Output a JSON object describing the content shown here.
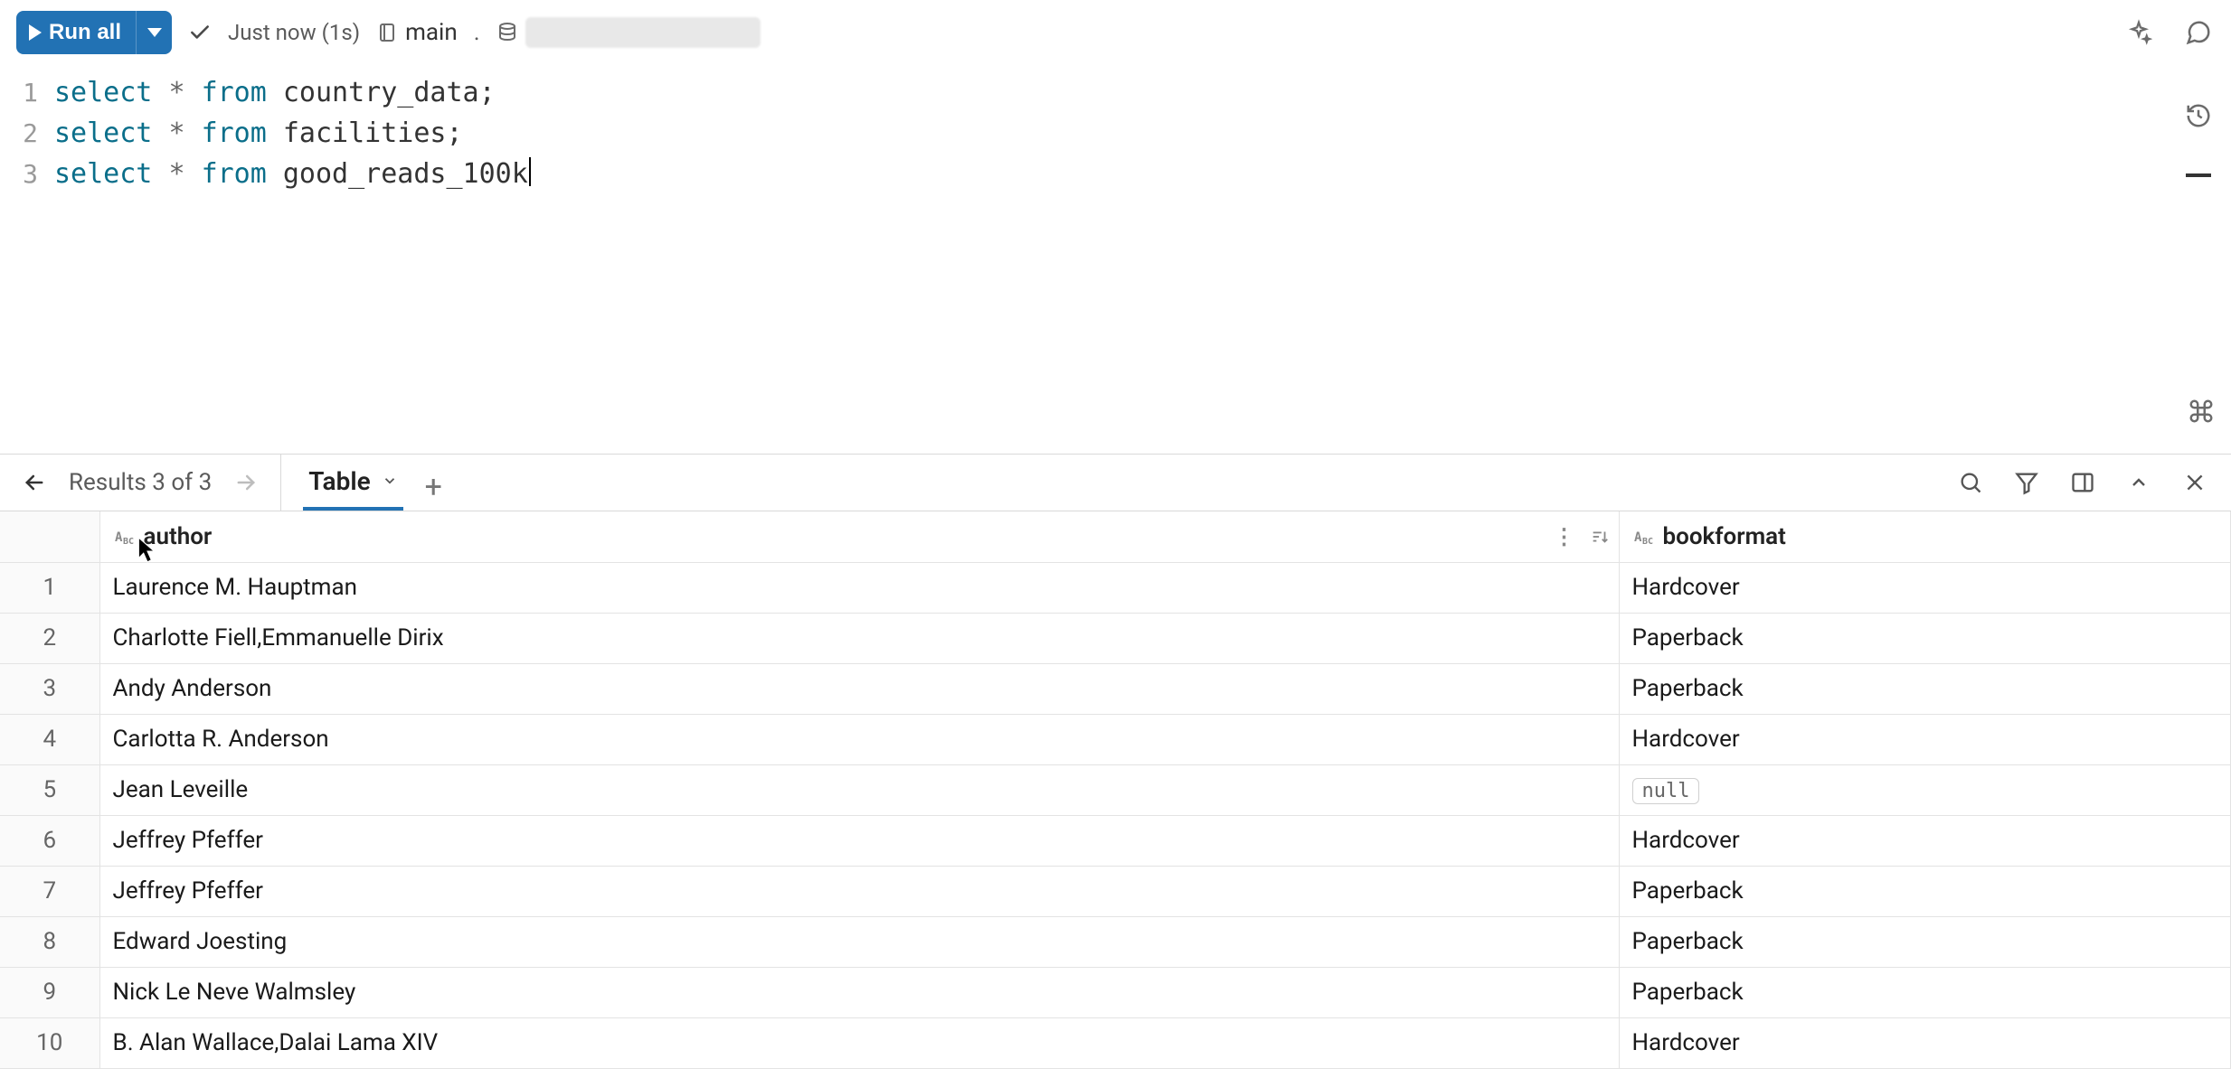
{
  "toolbar": {
    "run_all_label": "Run all",
    "status_text": "Just now (1s)",
    "catalog_name": "main",
    "schema_name_redacted": true
  },
  "editor": {
    "lines": [
      {
        "n": "1",
        "tokens": [
          {
            "t": "select",
            "c": "kw"
          },
          {
            "t": " ",
            "c": ""
          },
          {
            "t": "*",
            "c": "op"
          },
          {
            "t": " ",
            "c": ""
          },
          {
            "t": "from",
            "c": "kw"
          },
          {
            "t": " ",
            "c": ""
          },
          {
            "t": "country_data",
            "c": "id"
          },
          {
            "t": ";",
            "c": "punc"
          }
        ]
      },
      {
        "n": "2",
        "tokens": [
          {
            "t": "select",
            "c": "kw"
          },
          {
            "t": " ",
            "c": ""
          },
          {
            "t": "*",
            "c": "op"
          },
          {
            "t": " ",
            "c": ""
          },
          {
            "t": "from",
            "c": "kw"
          },
          {
            "t": " ",
            "c": ""
          },
          {
            "t": "facilities",
            "c": "id"
          },
          {
            "t": ";",
            "c": "punc"
          }
        ]
      },
      {
        "n": "3",
        "cursor_after": true,
        "tokens": [
          {
            "t": "select",
            "c": "kw"
          },
          {
            "t": " ",
            "c": ""
          },
          {
            "t": "*",
            "c": "op"
          },
          {
            "t": " ",
            "c": ""
          },
          {
            "t": "from",
            "c": "kw"
          },
          {
            "t": " ",
            "c": ""
          },
          {
            "t": "good_reads_100k",
            "c": "id"
          }
        ]
      }
    ]
  },
  "results": {
    "nav_label": "Results 3 of 3",
    "tab_label": "Table",
    "columns": [
      {
        "name": "author",
        "type_icon": "A"
      },
      {
        "name": "bookformat",
        "type_icon": "A"
      }
    ],
    "rows": [
      {
        "n": "1",
        "author": "Laurence M. Hauptman",
        "bookformat": "Hardcover"
      },
      {
        "n": "2",
        "author": "Charlotte Fiell,Emmanuelle Dirix",
        "bookformat": "Paperback"
      },
      {
        "n": "3",
        "author": "Andy Anderson",
        "bookformat": "Paperback"
      },
      {
        "n": "4",
        "author": "Carlotta R. Anderson",
        "bookformat": "Hardcover"
      },
      {
        "n": "5",
        "author": "Jean Leveille",
        "bookformat": null
      },
      {
        "n": "6",
        "author": "Jeffrey Pfeffer",
        "bookformat": "Hardcover"
      },
      {
        "n": "7",
        "author": "Jeffrey Pfeffer",
        "bookformat": "Paperback"
      },
      {
        "n": "8",
        "author": "Edward Joesting",
        "bookformat": "Paperback"
      },
      {
        "n": "9",
        "author": "Nick Le Neve Walmsley",
        "bookformat": "Paperback"
      },
      {
        "n": "10",
        "author": "B. Alan Wallace,Dalai Lama XIV",
        "bookformat": "Hardcover"
      }
    ],
    "null_label": "null"
  },
  "type_badge": {
    "string_prefix": "A",
    "string_suffix": "C"
  }
}
